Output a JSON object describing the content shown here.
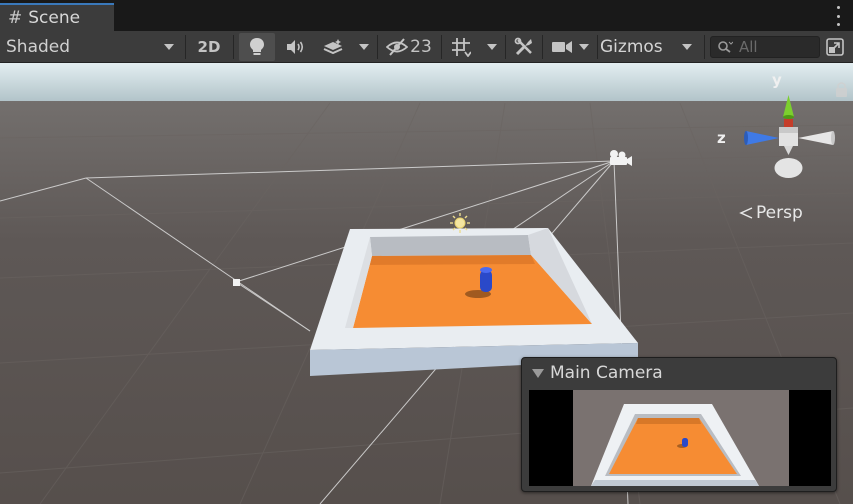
{
  "tab": {
    "title": "Scene",
    "icon": "hash-icon"
  },
  "toolbar": {
    "shading_mode": "Shaded",
    "toggle_2d": "2D",
    "hidden_count": "23",
    "gizmos_label": "Gizmos",
    "search_placeholder": "All",
    "lighting_active": true
  },
  "viewport": {
    "projection_label": "Persp",
    "axis_labels": {
      "y": "y",
      "z": "z"
    },
    "colors": {
      "sky": "#cfe4ea",
      "ground": "#5d5754",
      "floor": "#f68c33",
      "walls": "#e8ecf0",
      "capsule": "#2a49c9"
    }
  },
  "camera_preview": {
    "title": "Main Camera"
  }
}
